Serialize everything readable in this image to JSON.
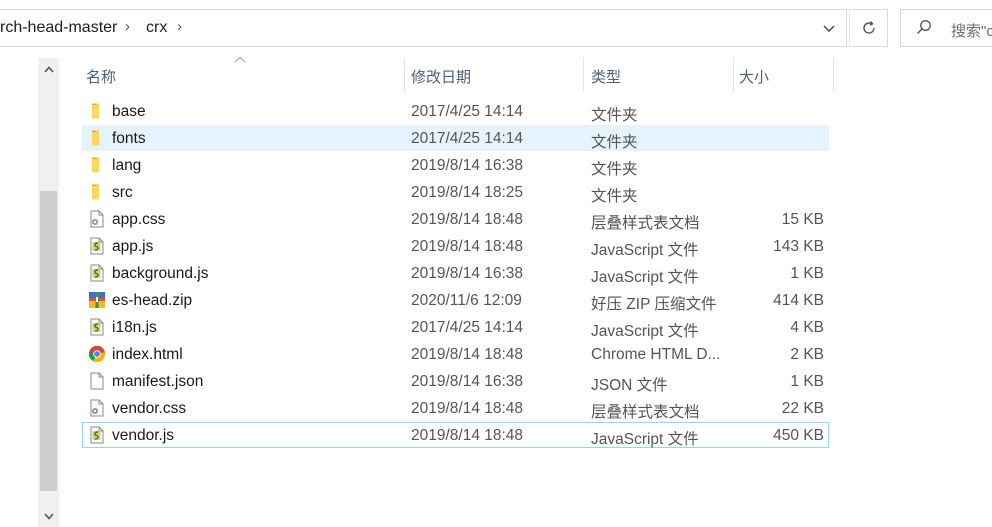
{
  "address": {
    "crumbs": [
      "rch-head-master",
      "crx"
    ],
    "separator": "›",
    "search_placeholder": "搜索\"c"
  },
  "columns": {
    "name": "名称",
    "date": "修改日期",
    "type": "类型",
    "size": "大小"
  },
  "files": [
    {
      "name": "base",
      "date": "2017/4/25 14:14",
      "type": "文件夹",
      "size": "",
      "icon": "folder-icon"
    },
    {
      "name": "fonts",
      "date": "2017/4/25 14:14",
      "type": "文件夹",
      "size": "",
      "icon": "folder-icon"
    },
    {
      "name": "lang",
      "date": "2019/8/14 16:38",
      "type": "文件夹",
      "size": "",
      "icon": "folder-icon"
    },
    {
      "name": "src",
      "date": "2019/8/14 18:25",
      "type": "文件夹",
      "size": "",
      "icon": "folder-icon"
    },
    {
      "name": "app.css",
      "date": "2019/8/14 18:48",
      "type": "层叠样式表文档",
      "size": "15 KB",
      "icon": "css-file-icon"
    },
    {
      "name": "app.js",
      "date": "2019/8/14 18:48",
      "type": "JavaScript 文件",
      "size": "143 KB",
      "icon": "js-file-icon"
    },
    {
      "name": "background.js",
      "date": "2019/8/14 16:38",
      "type": "JavaScript 文件",
      "size": "1 KB",
      "icon": "js-file-icon"
    },
    {
      "name": "es-head.zip",
      "date": "2020/11/6 12:09",
      "type": "好压 ZIP 压缩文件",
      "size": "414 KB",
      "icon": "zip-file-icon"
    },
    {
      "name": "i18n.js",
      "date": "2017/4/25 14:14",
      "type": "JavaScript 文件",
      "size": "4 KB",
      "icon": "js-file-icon"
    },
    {
      "name": "index.html",
      "date": "2019/8/14 18:48",
      "type": "Chrome HTML D...",
      "size": "2 KB",
      "icon": "chrome-icon"
    },
    {
      "name": "manifest.json",
      "date": "2019/8/14 16:38",
      "type": "JSON 文件",
      "size": "1 KB",
      "icon": "blank-file-icon"
    },
    {
      "name": "vendor.css",
      "date": "2019/8/14 18:48",
      "type": "层叠样式表文档",
      "size": "22 KB",
      "icon": "css-file-icon"
    },
    {
      "name": "vendor.js",
      "date": "2019/8/14 18:48",
      "type": "JavaScript 文件",
      "size": "450 KB",
      "icon": "js-file-icon"
    }
  ],
  "hovered_row": "fonts",
  "focused_row": "vendor.js"
}
